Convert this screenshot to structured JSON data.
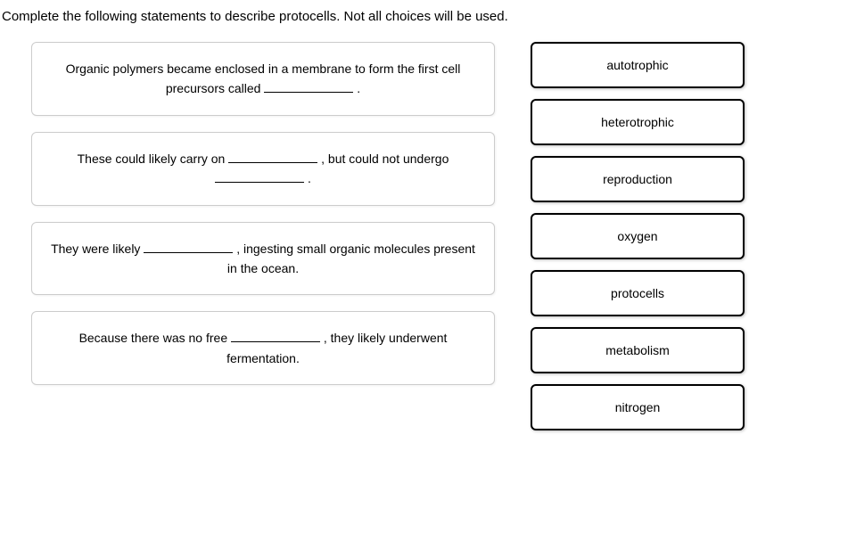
{
  "instruction": "Complete the following statements to describe protocells. Not all choices will be used.",
  "statements": [
    {
      "pre1": "Organic polymers became enclosed in a membrane to form the first cell precursors called ",
      "post1": " ."
    },
    {
      "pre1": "These could likely carry on ",
      "mid1": " , but could not undergo ",
      "post1": " ."
    },
    {
      "pre1": "They were likely ",
      "post1": " , ingesting small organic molecules present in the ocean."
    },
    {
      "pre1": "Because there was no free ",
      "post1": " , they likely underwent fermentation."
    }
  ],
  "choices": [
    "autotrophic",
    "heterotrophic",
    "reproduction",
    "oxygen",
    "protocells",
    "metabolism",
    "nitrogen"
  ]
}
